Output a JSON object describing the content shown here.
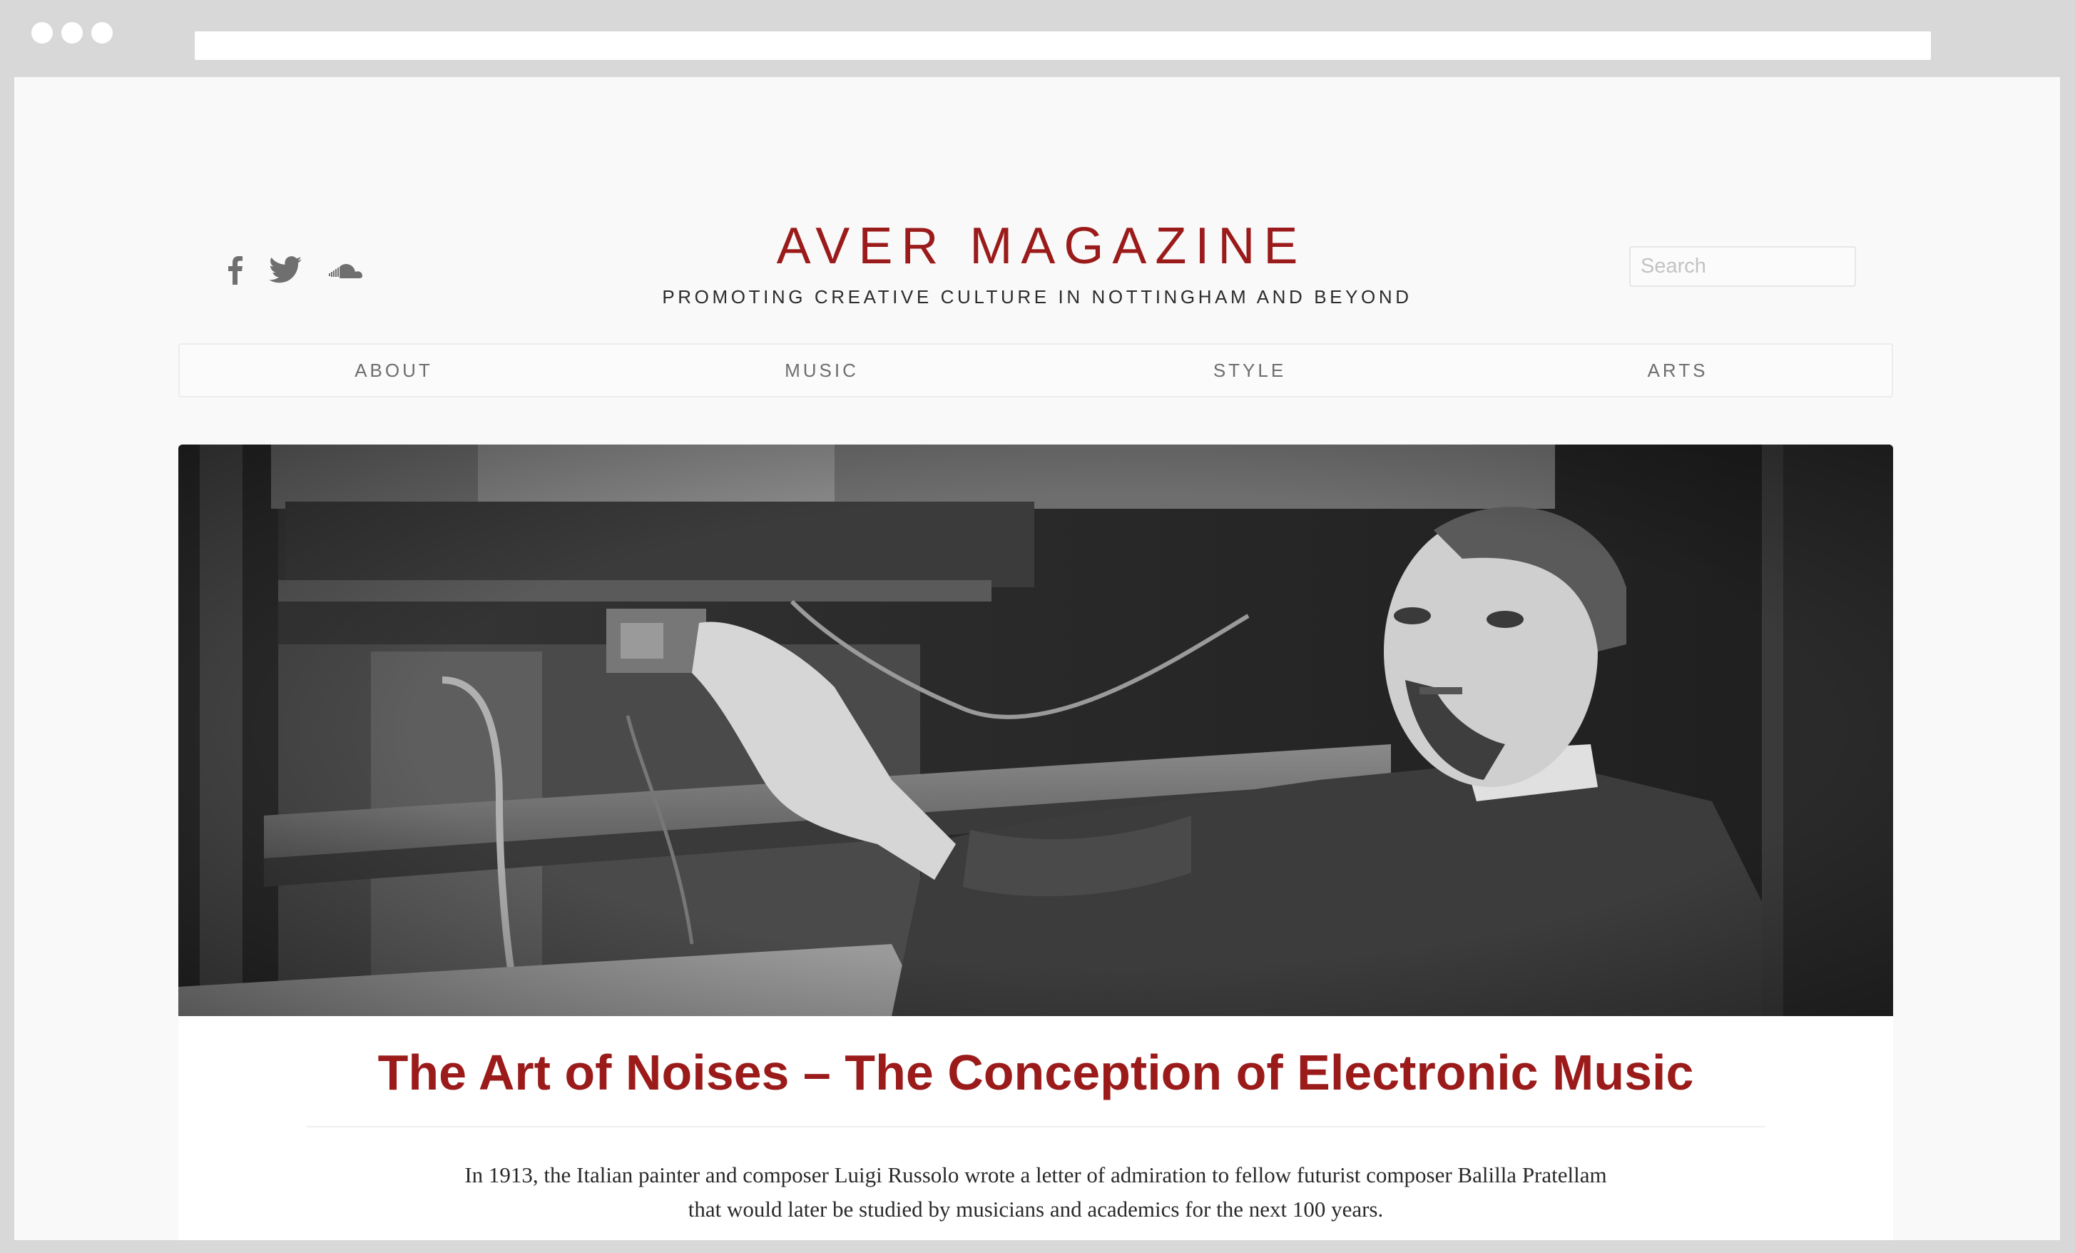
{
  "site": {
    "title": "AVER MAGAZINE",
    "tagline": "PROMOTING CREATIVE CULTURE IN NOTTINGHAM AND BEYOND",
    "brand_color": "#9b1b1b"
  },
  "social": {
    "icons": [
      "facebook-icon",
      "twitter-icon",
      "soundcloud-icon"
    ]
  },
  "search": {
    "placeholder": "Search",
    "value": ""
  },
  "nav": {
    "items": [
      {
        "label": "ABOUT"
      },
      {
        "label": "MUSIC"
      },
      {
        "label": "STYLE"
      },
      {
        "label": "ARTS"
      }
    ]
  },
  "article": {
    "title": "The Art of Noises – The Conception of Electronic Music",
    "intro": "In 1913, the Italian painter and composer Luigi Russolo wrote a letter of admiration to fellow futurist composer Balilla Pratellam that would later be studied by musicians and academics for the next 100 years.",
    "image": "black-and-white photograph of a man reaching toward a wooden noise-making machine"
  }
}
